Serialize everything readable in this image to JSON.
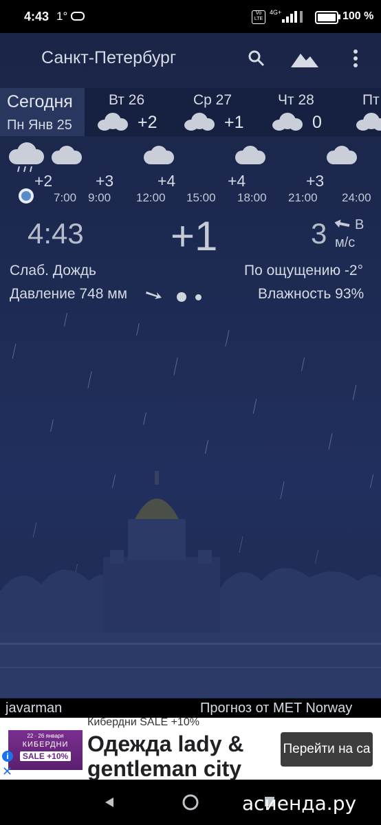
{
  "status_bar": {
    "time": "4:43",
    "temperature": "1°",
    "volte": "Vo LTE",
    "network": "4G+",
    "battery": "100 %"
  },
  "app_bar": {
    "city": "Санкт-Петербург",
    "icons": [
      "search-icon",
      "mountain-icon",
      "more-vertical-icon"
    ]
  },
  "days": {
    "today_label": "Сегодня",
    "today_date": "Пн Янв 25",
    "forecast": [
      {
        "day": "Вт 26",
        "icon": "cloud-icon",
        "temp": "+2"
      },
      {
        "day": "Ср 27",
        "icon": "cloud-icon",
        "temp": "+1"
      },
      {
        "day": "Чт 28",
        "icon": "cloud-icon",
        "temp": "0"
      },
      {
        "day": "Пт",
        "icon": "cloud-icon",
        "temp": ""
      }
    ]
  },
  "hourly": [
    {
      "time": "7:00",
      "temp": "+2",
      "icon": "rain-cloud-icon"
    },
    {
      "time": "9:00",
      "temp": "+3",
      "icon": "cloud-icon"
    },
    {
      "time": "12:00",
      "temp": "+4",
      "icon": "cloud-icon"
    },
    {
      "time": "15:00",
      "temp": "",
      "icon": ""
    },
    {
      "time": "18:00",
      "temp": "+4",
      "icon": "cloud-icon"
    },
    {
      "time": "21:00",
      "temp": "+3",
      "icon": "cloud-icon"
    },
    {
      "time": "24:00",
      "temp": "",
      "icon": ""
    }
  ],
  "current": {
    "time": "4:43",
    "temperature": "+1",
    "wind_speed": "3",
    "wind_direction": "В",
    "wind_unit": "м/с",
    "condition": "Слаб. Дождь",
    "feels_like": "По ощущению -2°",
    "pressure": "Давление 748 мм",
    "humidity": "Влажность 93%"
  },
  "credits": {
    "author": "javarman",
    "provider": "Прогноз от MET Norway"
  },
  "ad": {
    "top_text": "Кибердни SALE +10%",
    "image_line1": "22 · 26 января",
    "image_line2": "КИБЕРДНИ",
    "image_line3": "SALE +10%",
    "headline": "Одежда lady & gentleman city",
    "button": "Перейти на са",
    "accent_color": "#1a73e8"
  },
  "watermark": "асиенда.ру",
  "colors": {
    "background": "#1d2a52",
    "status_bar": "#000000",
    "now_dot": "#5a8bc9"
  }
}
